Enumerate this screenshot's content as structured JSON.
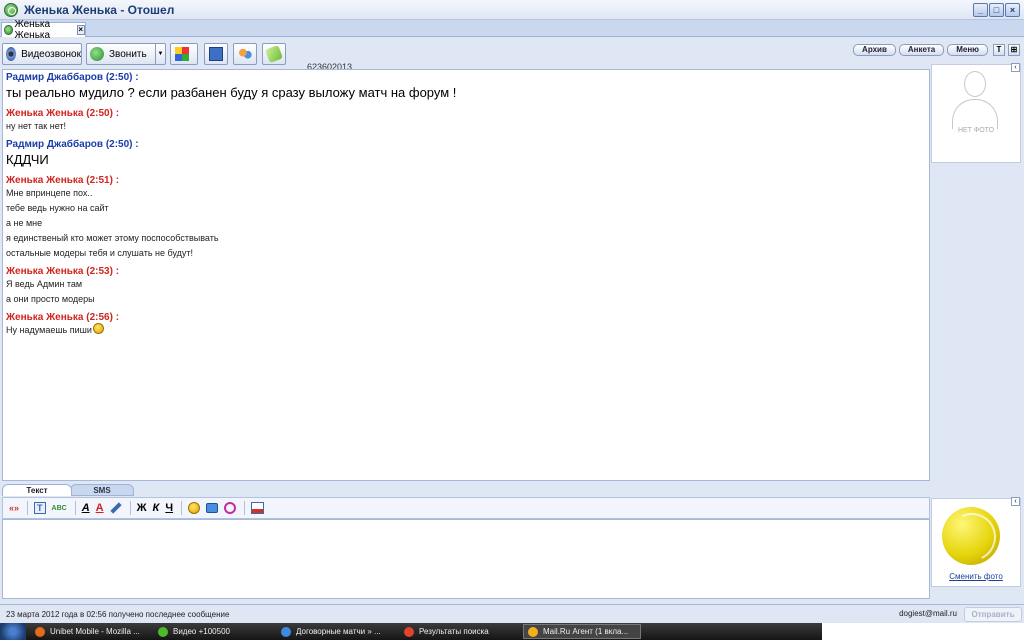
{
  "window": {
    "title": "Женька Женька - Отошел"
  },
  "tab": {
    "label": "Женька Женька"
  },
  "toolbar": {
    "video_call": "Видеозвонок",
    "call": "Звонить",
    "number": "623602013"
  },
  "right_tabs": [
    "Архив",
    "Анкета",
    "Меню"
  ],
  "right_icons": [
    "T",
    "⊞"
  ],
  "messages": [
    {
      "sender": "Радмир  Джаббаров (2:50) :",
      "color": "blue",
      "lines": [
        "ты реально мудило ? если разбанен буду я сразу выложу матч на форум !"
      ],
      "big": true
    },
    {
      "sender": "Женька Женька (2:50) :",
      "color": "red",
      "lines": [
        "ну нет так нет!"
      ],
      "big": false
    },
    {
      "sender": "Радмир  Джаббаров (2:50) :",
      "color": "blue",
      "lines": [
        "КДДЧИ"
      ],
      "big": true
    },
    {
      "sender": "Женька Женька (2:51) :",
      "color": "red",
      "lines": [
        "Мне впринцепе пох..",
        "тебе ведь нужно на сайт",
        "а не мне",
        "я единственый кто может этому поспособствывать",
        "остальные модеры тебя и слушать не будут!"
      ],
      "big": false
    },
    {
      "sender": "Женька Женька (2:53) :",
      "color": "red",
      "lines": [
        "Я ведь Админ там",
        "а они просто модеры"
      ],
      "big": false
    },
    {
      "sender": "Женька Женька (2:56) :",
      "color": "red",
      "lines": [
        "Ну надумаешь пиши"
      ],
      "big": false,
      "smiley": true
    }
  ],
  "photo_panel": {
    "no_photo": "НЕТ ФОТО"
  },
  "bottom_tabs": [
    "Текст",
    "SMS"
  ],
  "avatar_panel": {
    "change_photo": "Сменить фото"
  },
  "status": {
    "text": "23 марта 2012 года в 02:56 получено последнее сообщение",
    "email": "dogiest@mail.ru",
    "send": "Отправить"
  },
  "format_icons": [
    "«»",
    "T",
    "ABC",
    "A",
    "A",
    "pen",
    "Ж",
    "К",
    "Ч",
    "smile",
    "tv",
    "alarm",
    "screen"
  ],
  "taskbar": [
    {
      "label": "Unibet Mobile - Mozilla ...",
      "icon_color": "#e66a1c"
    },
    {
      "label": "Видео +100500",
      "icon_color": "#4cbb2b"
    },
    {
      "label": "Договорные матчи » ...",
      "icon_color": "#3f8be0"
    },
    {
      "label": "Результаты поиска",
      "icon_color": "#e0452b"
    },
    {
      "label": "Mail.Ru Агент (1 вкла...",
      "icon_color": "#f0b020",
      "active": true
    }
  ]
}
